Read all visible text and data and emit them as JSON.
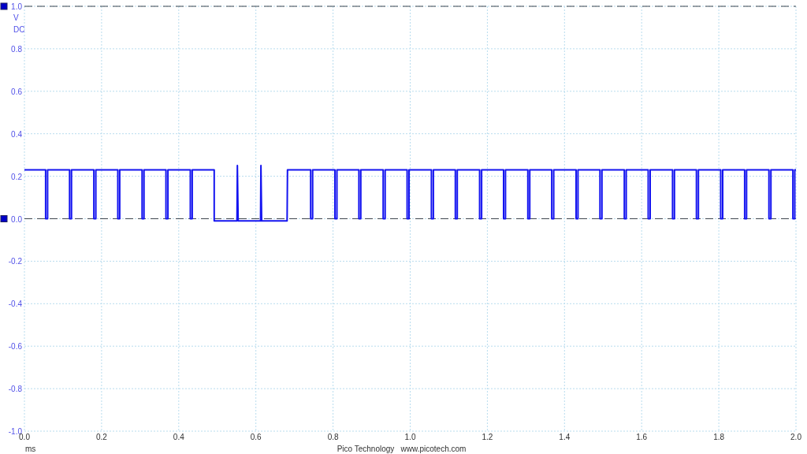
{
  "scope": {
    "coupling": "DC",
    "chart_data": {
      "type": "line",
      "xlabel": "ms",
      "ylabel": "V",
      "xlim": [
        0,
        2
      ],
      "ylim": [
        -1,
        1
      ],
      "xticks": [
        {
          "value": 0,
          "label": "0.0"
        },
        {
          "value": 0.2,
          "label": "0.2"
        },
        {
          "value": 0.4,
          "label": "0.4"
        },
        {
          "value": 0.6,
          "label": "0.6"
        },
        {
          "value": 0.8,
          "label": "0.8"
        },
        {
          "value": 1,
          "label": "1.0"
        },
        {
          "value": 1.2,
          "label": "1.2"
        },
        {
          "value": 1.4,
          "label": "1.4"
        },
        {
          "value": 1.6,
          "label": "1.6"
        },
        {
          "value": 1.8,
          "label": "1.8"
        },
        {
          "value": 2,
          "label": "2.0"
        }
      ],
      "yticks": [
        {
          "value": 1,
          "label": "1.0"
        },
        {
          "value": 0.8,
          "label": "0.8"
        },
        {
          "value": 0.6,
          "label": "0.6"
        },
        {
          "value": 0.4,
          "label": "0.4"
        },
        {
          "value": 0.2,
          "label": "0.2"
        },
        {
          "value": 0,
          "label": "0.0"
        },
        {
          "value": -0.2,
          "label": "-0.2"
        },
        {
          "value": -0.4,
          "label": "-0.4"
        },
        {
          "value": -0.6,
          "label": "-0.6"
        },
        {
          "value": -0.8,
          "label": "-0.8"
        },
        {
          "value": -1,
          "label": "-1.0"
        }
      ],
      "x": [
        0,
        0.055,
        0.055,
        0.06,
        0.06,
        0.117,
        0.117,
        0.122,
        0.122,
        0.18,
        0.18,
        0.185,
        0.185,
        0.242,
        0.242,
        0.247,
        0.247,
        0.305,
        0.305,
        0.31,
        0.31,
        0.367,
        0.367,
        0.372,
        0.372,
        0.43,
        0.43,
        0.435,
        0.435,
        0.492,
        0.492,
        0.551,
        0.552,
        0.554,
        0.612,
        0.613,
        0.615,
        0.681,
        0.682,
        0.742,
        0.742,
        0.747,
        0.747,
        0.805,
        0.805,
        0.81,
        0.81,
        0.867,
        0.867,
        0.872,
        0.872,
        0.93,
        0.93,
        0.935,
        0.935,
        0.992,
        0.992,
        0.997,
        0.997,
        1.055,
        1.055,
        1.06,
        1.06,
        1.117,
        1.117,
        1.122,
        1.122,
        1.18,
        1.18,
        1.185,
        1.185,
        1.242,
        1.242,
        1.247,
        1.247,
        1.305,
        1.305,
        1.31,
        1.31,
        1.367,
        1.367,
        1.372,
        1.372,
        1.43,
        1.43,
        1.435,
        1.435,
        1.492,
        1.492,
        1.497,
        1.497,
        1.555,
        1.555,
        1.56,
        1.56,
        1.617,
        1.617,
        1.622,
        1.622,
        1.68,
        1.68,
        1.685,
        1.685,
        1.742,
        1.742,
        1.747,
        1.747,
        1.805,
        1.805,
        1.81,
        1.81,
        1.867,
        1.867,
        1.872,
        1.872,
        1.93,
        1.93,
        1.935,
        1.935,
        1.992,
        1.992,
        1.997,
        1.997,
        2
      ],
      "values": [
        0.23,
        0.23,
        0,
        0,
        0.23,
        0.23,
        0,
        0,
        0.23,
        0.23,
        0,
        0,
        0.23,
        0.23,
        0,
        0,
        0.23,
        0.23,
        0,
        0,
        0.23,
        0.23,
        0,
        0,
        0.23,
        0.23,
        0,
        0,
        0.23,
        0.23,
        -0.01,
        -0.01,
        0.25,
        -0.01,
        -0.01,
        0.25,
        -0.01,
        -0.01,
        0.23,
        0.23,
        0,
        0,
        0.23,
        0.23,
        0,
        0,
        0.23,
        0.23,
        0,
        0,
        0.23,
        0.23,
        0,
        0,
        0.23,
        0.23,
        0,
        0,
        0.23,
        0.23,
        0,
        0,
        0.23,
        0.23,
        0,
        0,
        0.23,
        0.23,
        0,
        0,
        0.23,
        0.23,
        0,
        0,
        0.23,
        0.23,
        0,
        0,
        0.23,
        0.23,
        0,
        0,
        0.23,
        0.23,
        0,
        0,
        0.23,
        0.23,
        0,
        0,
        0.23,
        0.23,
        0,
        0,
        0.23,
        0.23,
        0,
        0,
        0.23,
        0.23,
        0,
        0,
        0.23,
        0.23,
        0,
        0,
        0.23,
        0.23,
        0,
        0,
        0.23,
        0.23,
        0,
        0,
        0.23,
        0.23,
        0,
        0,
        0.23,
        0.23,
        0,
        0,
        0.23,
        0.23
      ],
      "grid": true,
      "ref_lines": [
        {
          "axis": "y",
          "value": 1
        },
        {
          "axis": "y",
          "value": 0
        }
      ]
    }
  },
  "footer": {
    "company": "Pico Technology",
    "website": "www.picotech.com"
  }
}
